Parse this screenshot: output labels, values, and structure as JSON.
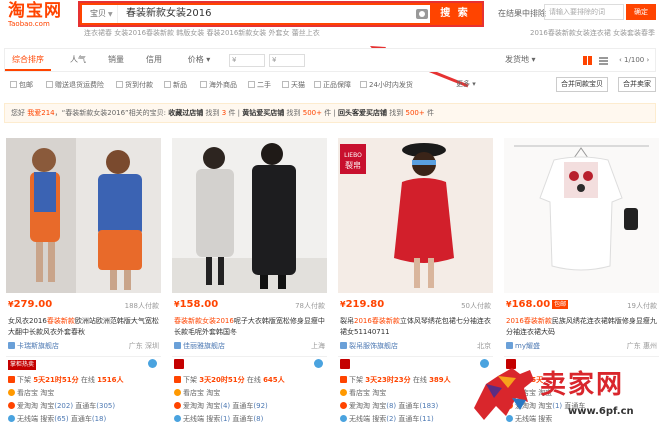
{
  "header": {
    "logo_cn": "淘宝网",
    "logo_en": "Taobao.com",
    "search_category": "宝贝",
    "search_query": "春装新款女装2016",
    "search_button": "搜 索",
    "sub_links": "连衣裙春  女装2016春装新款  韩版女装  春装2016新款女装  外套女  蕾丝上衣",
    "in_result_label": "在结果中排除",
    "keyword_placeholder": "请输入要排除的词",
    "keyword_button": "确定",
    "right_sub": "2016春装新款女装连衣裙  女装套装春季"
  },
  "sortbar": {
    "tabs": [
      "综合排序",
      "人气",
      "销量",
      "信用",
      "价格"
    ],
    "price_from": "¥",
    "price_to": "¥",
    "ship_from": "发货地",
    "page": "1/100"
  },
  "filters": {
    "checkboxes": [
      "包邮",
      "赠送退货运费险",
      "货到付款",
      "新品",
      "海外商品",
      "二手",
      "天猫",
      "正品保障",
      "24小时内发货"
    ],
    "more": "更多",
    "btn_merge": "合并同款宝贝",
    "btn_seller": "合并卖家"
  },
  "tip": {
    "prefix": "您好",
    "user": "我爱214",
    "mid1": "，“春装新款女装2016”相关的宝贝:",
    "label1": "收藏过店铺",
    "find1": "找到",
    "count1": "3",
    "unit1": "件",
    "label2": "黄钻爱买店铺",
    "find2": "找到",
    "count2": "500+",
    "unit2": "件",
    "label3": "回头客爱买店铺",
    "find3": "找到",
    "count3": "500+",
    "unit3": "件"
  },
  "products": [
    {
      "price": "279.00",
      "sold": "188人付款",
      "title_pre": "女风衣2016",
      "title_red": "春装新款",
      "title_post": "欧洲站欧洲范韩版大气宽松大翻中长款风衣外套春秋",
      "shop": "卡瑞斯旗舰店",
      "location": "广东 深圳",
      "badge": "掌柜热卖",
      "time_line_pre": "下架",
      "time_line_time": "5天21时51分",
      "time_line_online_label": "在线",
      "time_line_online": "1516人",
      "seller_line": "看店宝 淘宝",
      "r1_label": "爱淘淘 淘宝",
      "r1_num": "(202)",
      "r1_label2": "直通车",
      "r1_num2": "(305)",
      "r2_label": "无线端 搜索",
      "r2_num": "(65)",
      "r2_label2": "直通车",
      "r2_num2": "(18)"
    },
    {
      "price": "158.00",
      "sold": "78人付款",
      "title_pre": "",
      "title_red": "春装新款女装2016",
      "title_post": "呢子大衣韩版宽松修身显瘦中长款毛呢外套韩国冬",
      "shop": "佳丽雅旗舰店",
      "location": "上海",
      "badge": "",
      "time_line_pre": "下架",
      "time_line_time": "3天20时51分",
      "time_line_online_label": "在线",
      "time_line_online": "645人",
      "seller_line": "看店宝 淘宝",
      "r1_label": "爱淘淘 淘宝",
      "r1_num": "(4)",
      "r1_label2": "直通车",
      "r1_num2": "(92)",
      "r2_label": "无线端 搜索",
      "r2_num": "(1)",
      "r2_label2": "直通车",
      "r2_num2": "(8)"
    },
    {
      "price": "219.80",
      "sold": "50人付款",
      "title_pre": "裂帛",
      "title_red": "2016春装新款",
      "title_post": "立体风琴绣花包裙七分袖连衣裙女51140711",
      "shop": "裂帛服饰旗舰店",
      "location": "北京",
      "badge": "",
      "time_line_pre": "下架",
      "time_line_time": "3天23时23分",
      "time_line_online_label": "在线",
      "time_line_online": "389人",
      "seller_line": "看店宝 淘宝",
      "r1_label": "爱淘淘 淘宝",
      "r1_num": "(8)",
      "r1_label2": "直通车",
      "r1_num2": "(183)",
      "r2_label": "无线端 搜索",
      "r2_num": "(2)",
      "r2_label2": "直通车",
      "r2_num2": "(11)"
    },
    {
      "price": "168.00",
      "sold": "19人付款",
      "title_pre": "",
      "title_red": "2016春装新款",
      "title_post": "民族风绣花连衣裙韩版修身显瘦九分袖连衣裙大码",
      "shop": "my耀盛",
      "location": "广东 惠州",
      "badge": "",
      "time_line_pre": "下架",
      "time_line_time": "5天",
      "time_line_online_label": "",
      "time_line_online": "",
      "seller_line": "看店宝 淘宝",
      "r1_label": "爱淘淘 淘宝",
      "r1_num": "(1)",
      "r1_label2": "直通车",
      "r1_num2": "",
      "r2_label": "无线端 搜索",
      "r2_num": "",
      "r2_label2": "",
      "r2_num2": ""
    }
  ],
  "watermark": {
    "text": "卖家网",
    "url": "www.6pf.cn"
  },
  "colors": {
    "brand": "#ff4400",
    "highlight_box": "#e63232"
  }
}
